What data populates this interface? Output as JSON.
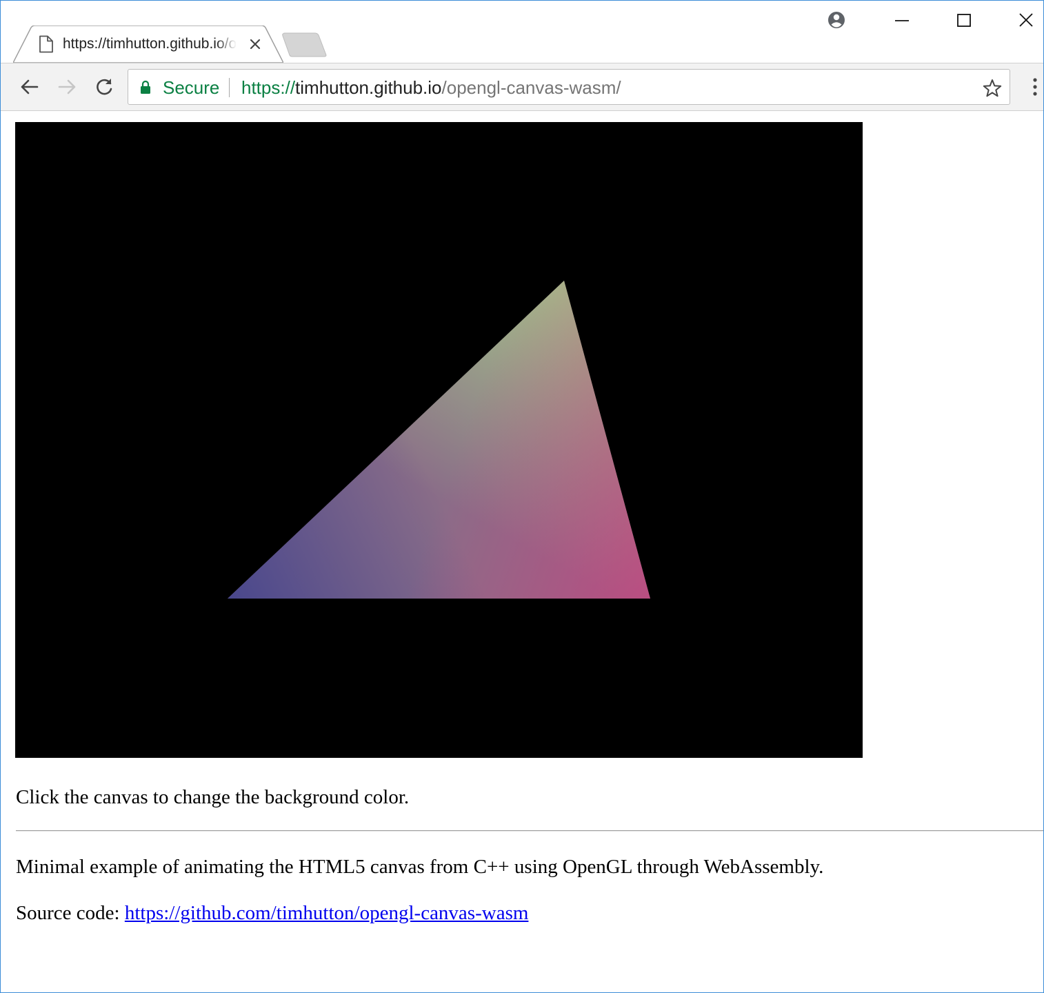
{
  "browser": {
    "tab": {
      "title": "https://timhutton.github.io/opengl-canvas-wasm/",
      "icon": "page-icon"
    },
    "omnibox": {
      "secure_label": "Secure",
      "url_scheme": "https://",
      "url_host": "timhutton.github.io",
      "url_path": "/opengl-canvas-wasm/"
    },
    "icons": {
      "back": "arrow-left-icon",
      "forward": "arrow-right-icon",
      "reload": "reload-icon",
      "lock": "lock-icon",
      "bookmark": "star-icon",
      "menu": "kebab-menu-icon",
      "profile": "profile-icon",
      "minimize": "minimize-icon",
      "maximize": "maximize-icon",
      "close": "close-icon"
    },
    "colors": {
      "secure_green": "#0b8043",
      "window_border": "#3c8dd8",
      "link_blue": "#0000ee"
    }
  },
  "page": {
    "canvas": {
      "background": "#000000",
      "triangle_colors": {
        "top": "#a3c28a",
        "bottom_left": "#47468d",
        "bottom_right": "#c9427f"
      }
    },
    "instruction": "Click the canvas to change the background color.",
    "description": "Minimal example of animating the HTML5 canvas from C++ using OpenGL through WebAssembly.",
    "source_label": "Source code: ",
    "source_link": "https://github.com/timhutton/opengl-canvas-wasm"
  }
}
